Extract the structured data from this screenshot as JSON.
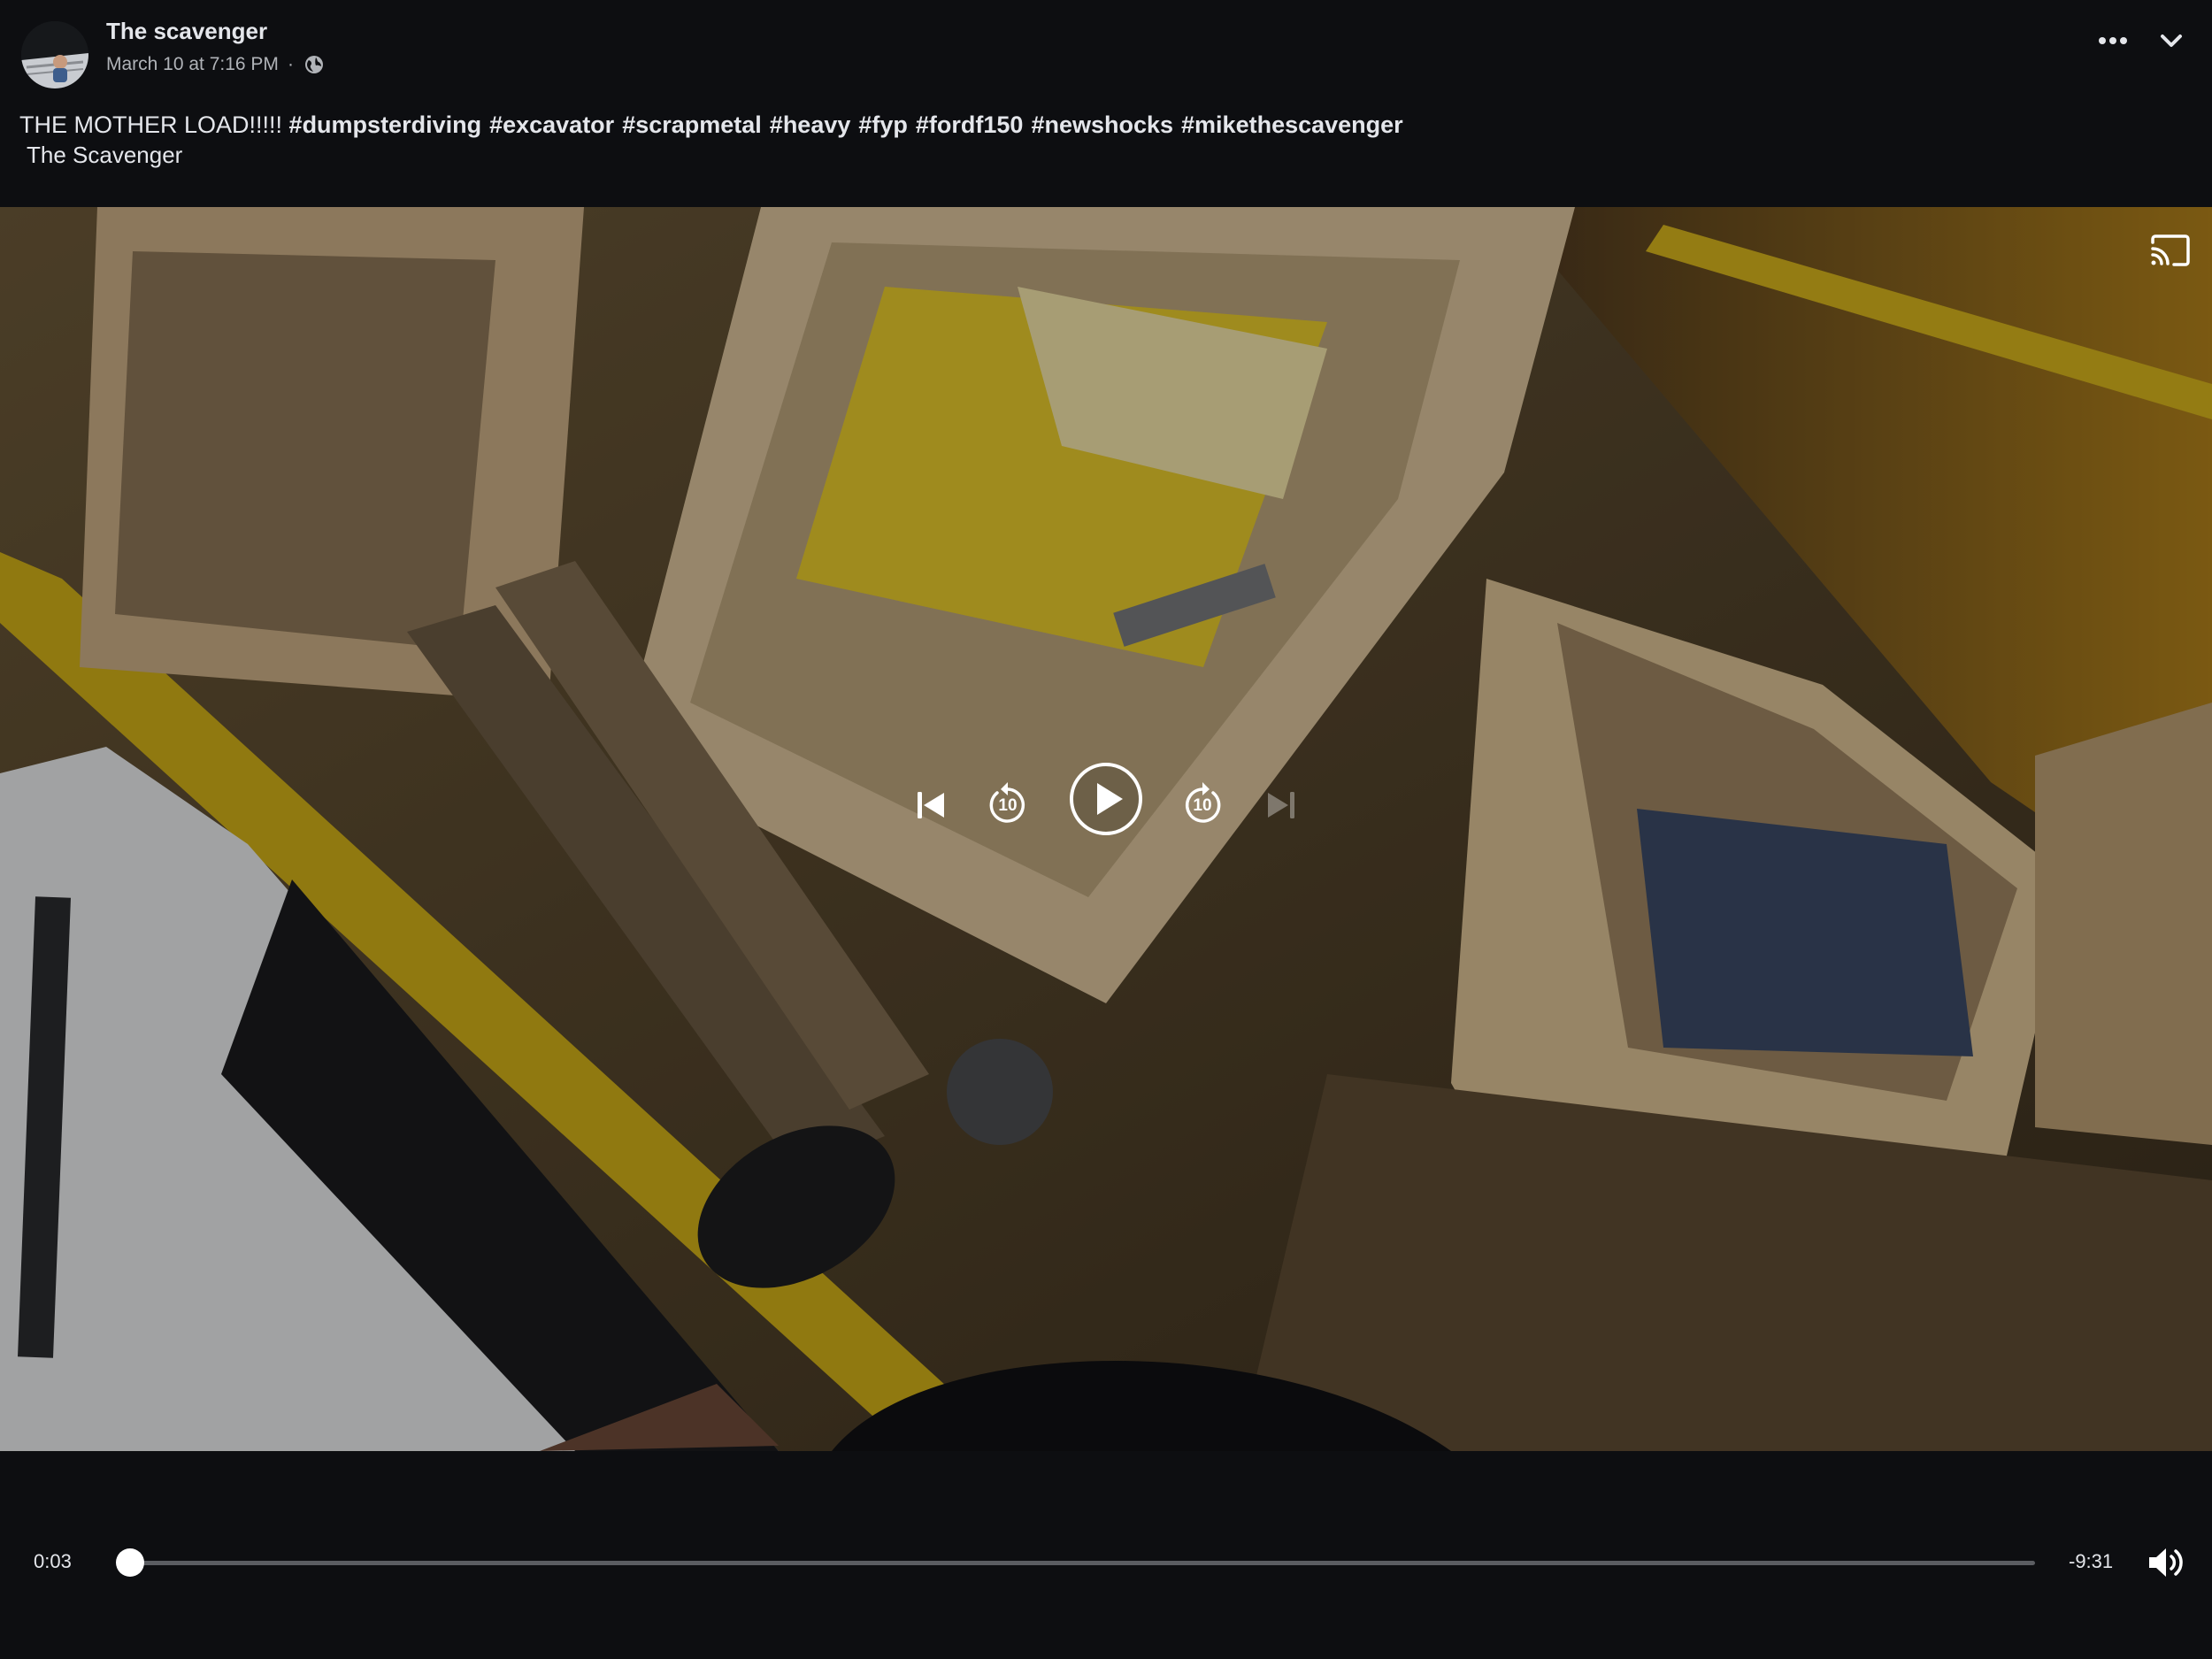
{
  "post": {
    "author": "The scavenger",
    "date": "March 10 at 7:16 PM",
    "separator": "·",
    "audience_icon": "globe-icon",
    "caption_text": "THE MOTHER LOAD!!!!!",
    "hashtags": [
      "#dumpsterdiving",
      "#excavator",
      "#scrapmetal",
      "#heavy",
      "#fyp",
      "#fordf150",
      "#newshocks",
      "#mikethescavenger"
    ],
    "caption_subline": "The Scavenger",
    "icons": {
      "more": "more-dots-icon",
      "collapse": "chevron-down-icon"
    }
  },
  "video": {
    "icons": {
      "cast": "cast-icon",
      "previous": "skip-previous-icon",
      "rewind": "rewind-10-icon",
      "play": "play-icon",
      "forward": "forward-10-icon",
      "next": "skip-next-icon"
    },
    "rewind_label": "10",
    "forward_label": "10"
  },
  "player": {
    "elapsed": "0:03",
    "remaining": "-9:31",
    "progress_fraction": 0.005,
    "volume_icon": "volume-icon"
  },
  "colors": {
    "background": "#0d0e11",
    "text": "#e4e6eb",
    "muted_text": "#b0b3b8",
    "track": "#5b5d62",
    "accent": "#ffffff"
  }
}
